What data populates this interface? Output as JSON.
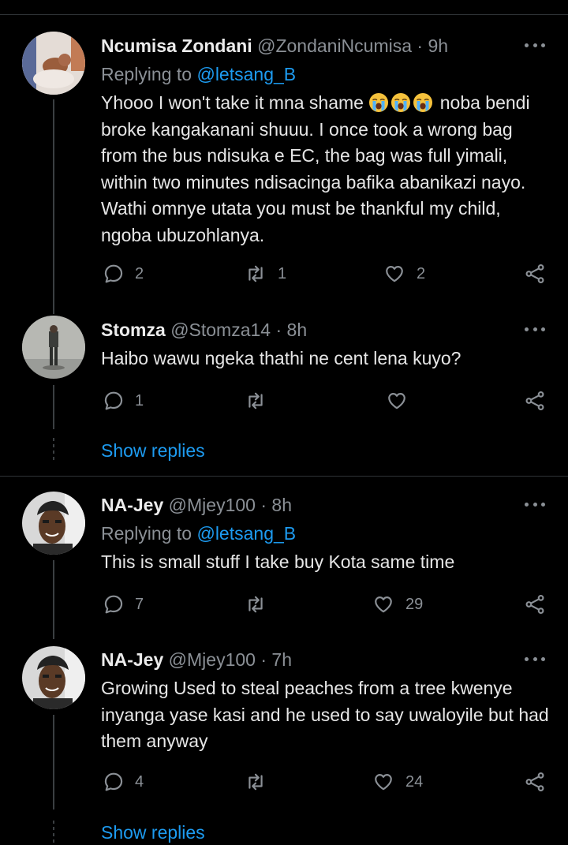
{
  "tweets": [
    {
      "name": "Ncumisa Zondani",
      "handle": "@ZondaniNcumisa",
      "sep": "·",
      "time": "9h",
      "reply_prefix": "Replying to",
      "reply_to": "@letsang_B",
      "text_before_emoji": "Yhooo I won't take it mna shame",
      "emojis": [
        "loudly-crying-face",
        "loudly-crying-face",
        "loudly-crying-face"
      ],
      "text_after_emoji": "noba bendi broke kangakanani shuuu. I once took a wrong bag from the bus ndisuka e EC, the bag was full yimali, within two minutes ndisacinga bafika abanikazi nayo. Wathi omnye utata you must be thankful my child, ngoba ubuzohlanya.",
      "replies": "2",
      "retweets": "1",
      "likes": "2"
    },
    {
      "name": "Stomza",
      "handle": "@Stomza14",
      "sep": "·",
      "time": "8h",
      "text": "Haibo wawu ngeka thathi ne cent lena kuyo?",
      "replies": "1",
      "retweets": "",
      "likes": ""
    },
    {
      "name": "NA-Jey",
      "handle": "@Mjey100",
      "sep": "·",
      "time": "8h",
      "reply_prefix": "Replying to",
      "reply_to": "@letsang_B",
      "text": "This is small stuff I take buy Kota same time",
      "replies": "7",
      "retweets": "",
      "likes": "29"
    },
    {
      "name": "NA-Jey",
      "handle": "@Mjey100",
      "sep": "·",
      "time": "7h",
      "text": "Growing Used to steal peaches from a tree kwenye inyanga yase kasi and he used to say uwaloyile but had them anyway",
      "replies": "4",
      "retweets": "",
      "likes": "24"
    }
  ],
  "show_replies_label": "Show replies",
  "colors": {
    "background": "#000000",
    "accent": "#1d9bf0",
    "muted": "#8b9096",
    "text": "#e6e6e6"
  },
  "icons": [
    "reply-icon",
    "retweet-icon",
    "like-icon",
    "share-icon",
    "more-icon"
  ]
}
